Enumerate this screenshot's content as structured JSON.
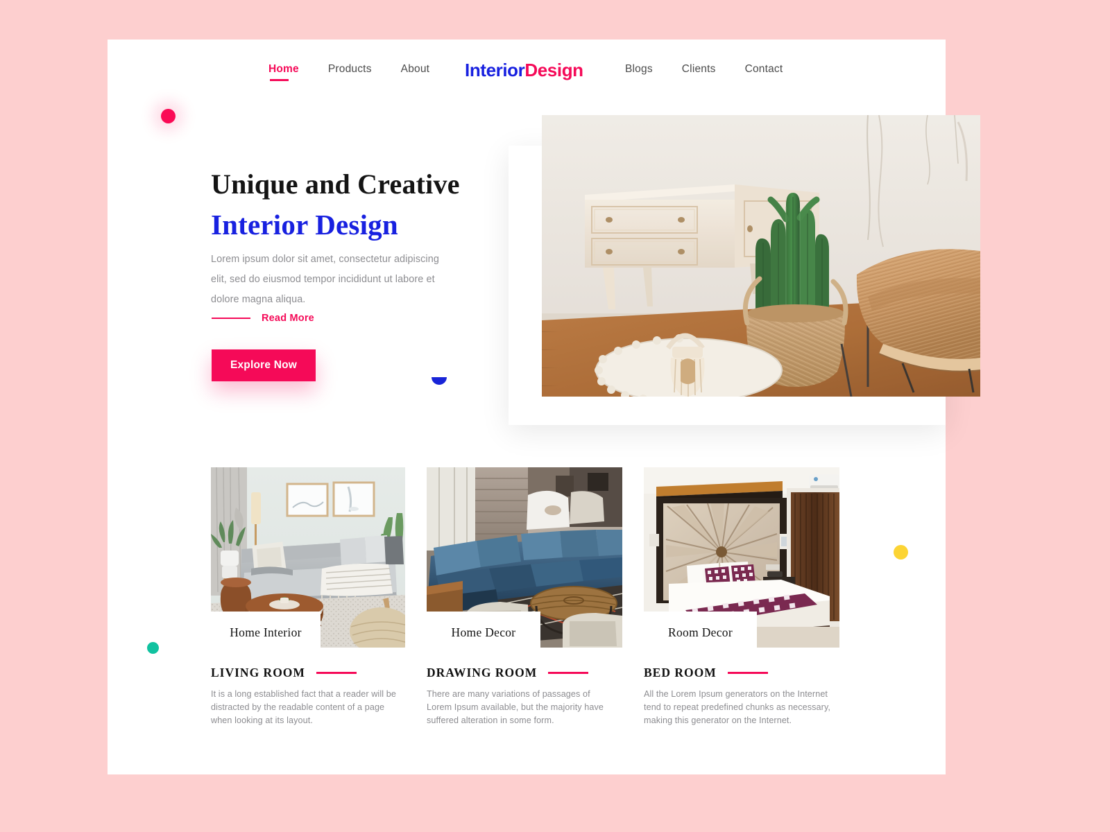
{
  "theme": {
    "background": "#fdcfcf",
    "panel": "#ffffff",
    "accent_pink": "#f50a58",
    "accent_blue": "#1821e0",
    "teal": "#11c2a0",
    "yellow": "#fcd434",
    "muted_text": "#8d8d91"
  },
  "nav": {
    "left_items": [
      {
        "label": "Home",
        "active": true
      },
      {
        "label": "Products",
        "active": false
      },
      {
        "label": "About",
        "active": false
      }
    ],
    "brand": {
      "part1": "Interior",
      "part2": "Design"
    },
    "right_items": [
      {
        "label": "Blogs",
        "active": false
      },
      {
        "label": "Clients",
        "active": false
      },
      {
        "label": "Contact",
        "active": false
      }
    ]
  },
  "hero": {
    "title_line1": "Unique and Creative",
    "title_line2": "Interior Design",
    "paragraph": "Lorem ipsum dolor sit amet, consectetur adipiscing elit, sed do eiusmod tempor incididunt ut labore et dolore magna aliqua.",
    "read_more": "Read More",
    "cta": "Explore Now",
    "image_alt": "interior-room-with-cactus-and-wicker-chair"
  },
  "decorations": [
    {
      "name": "pink-dot",
      "color": "#f50a58"
    },
    {
      "name": "teal-dot",
      "color": "#11c2a0"
    },
    {
      "name": "yellow-dot",
      "color": "#fcd434"
    },
    {
      "name": "blue-half-moon",
      "color": "#1824d8"
    }
  ],
  "cards": [
    {
      "tag": "Home Interior",
      "heading": "LIVING ROOM",
      "paragraph": "It is a long established fact that a reader will be distracted by the readable content of a page when looking at its layout.",
      "image_alt": "living-room-gray-sofa-with-framed-art"
    },
    {
      "tag": "Home Decor",
      "heading": "DRAWING ROOM",
      "paragraph": "There are many variations of passages of Lorem Ipsum available, but the majority have suffered alteration in some form.",
      "image_alt": "industrial-loft-blue-sectional-sofa"
    },
    {
      "tag": "Room Decor",
      "heading": "BED ROOM",
      "paragraph": "All the Lorem Ipsum generators on the Internet tend to repeat predefined chunks as necessary, making this generator on the Internet.",
      "image_alt": "hotel-bedroom-with-starburst-headboard"
    }
  ]
}
